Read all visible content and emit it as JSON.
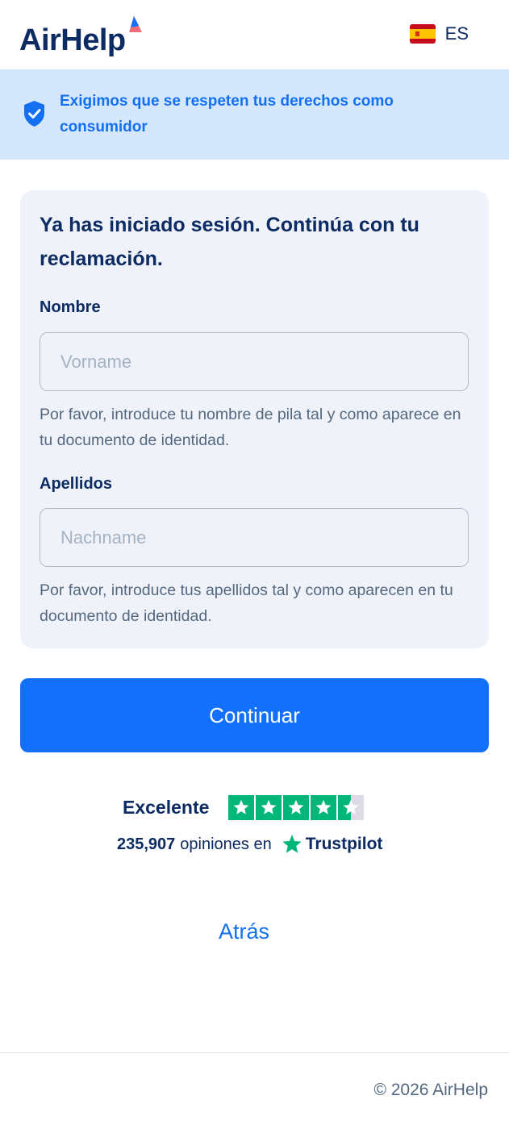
{
  "header": {
    "logo_text": "AirHelp",
    "language_code": "ES"
  },
  "banner": {
    "text": "Exigimos que se respeten tus derechos como consumidor"
  },
  "form": {
    "title": "Ya has iniciado sesión. Continúa con tu reclamación.",
    "first_name": {
      "label": "Nombre",
      "placeholder": "Vorname",
      "value": "",
      "help": "Por favor, introduce tu nombre de pila tal y como aparece en tu documento de identidad."
    },
    "last_name": {
      "label": "Apellidos",
      "placeholder": "Nachname",
      "value": "",
      "help": "Por favor, introduce tus apellidos tal y como aparecen en tu documento de identidad."
    }
  },
  "continue_label": "Continuar",
  "trustpilot": {
    "rating_label": "Excelente",
    "stars": 4.5,
    "review_count": "235,907",
    "reviews_text": "opiniones en",
    "brand": "Trustpilot"
  },
  "back_label": "Atrás",
  "footer": {
    "copyright": "© 2026 AirHelp"
  },
  "colors": {
    "primary": "#1370fb",
    "navy": "#0c2b63",
    "banner_bg": "#d4e7fc",
    "card_bg": "#eff3f9",
    "trustpilot_green": "#00b67a"
  },
  "icons": {
    "banner": "shield-check-icon",
    "flag": "spain-flag-icon",
    "trustpilot": "trustpilot-star-icon"
  }
}
